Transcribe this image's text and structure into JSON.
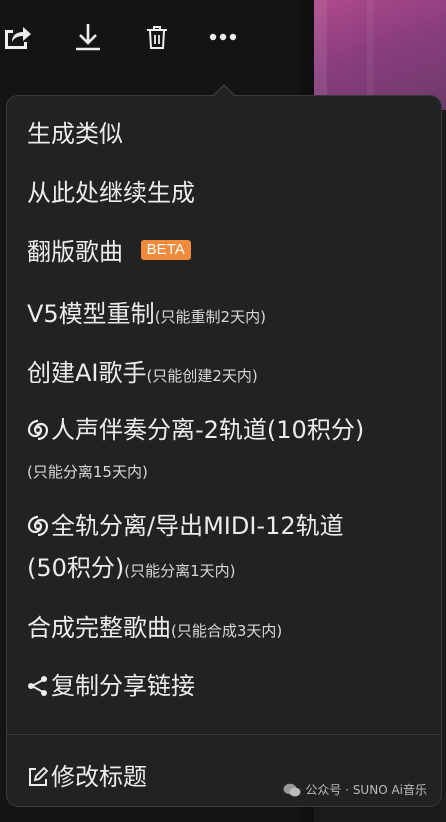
{
  "toolbar": {
    "icons": [
      "share-icon",
      "download-icon",
      "trash-icon",
      "more-icon"
    ]
  },
  "menu": {
    "item1": "生成类似",
    "item2": "从此处继续生成",
    "item3": "翻版歌曲",
    "item3_badge": "BETA",
    "item4_main": "V5模型重制",
    "item4_sub": "(只能重制2天内)",
    "item5_main": "创建AI歌手",
    "item5_sub": "(只能创建2天内)",
    "item6_main": "人声伴奏分离-2轨道(10积分)",
    "item6_sub": "(只能分离15天内)",
    "item7_main": "全轨分离/导出MIDI-12轨道",
    "item7_main2": "(50积分)",
    "item7_sub": "(只能分离1天内)",
    "item8_main": "合成完整歌曲",
    "item8_sub": "(只能合成3天内)",
    "item9": "复制分享链接",
    "item10": "修改标题"
  },
  "watermark": {
    "text": "公众号 · SUNO Ai音乐"
  },
  "colors": {
    "menu_bg": "#222222",
    "badge": "#f08a3c",
    "accent_image": "#b04a8c"
  }
}
